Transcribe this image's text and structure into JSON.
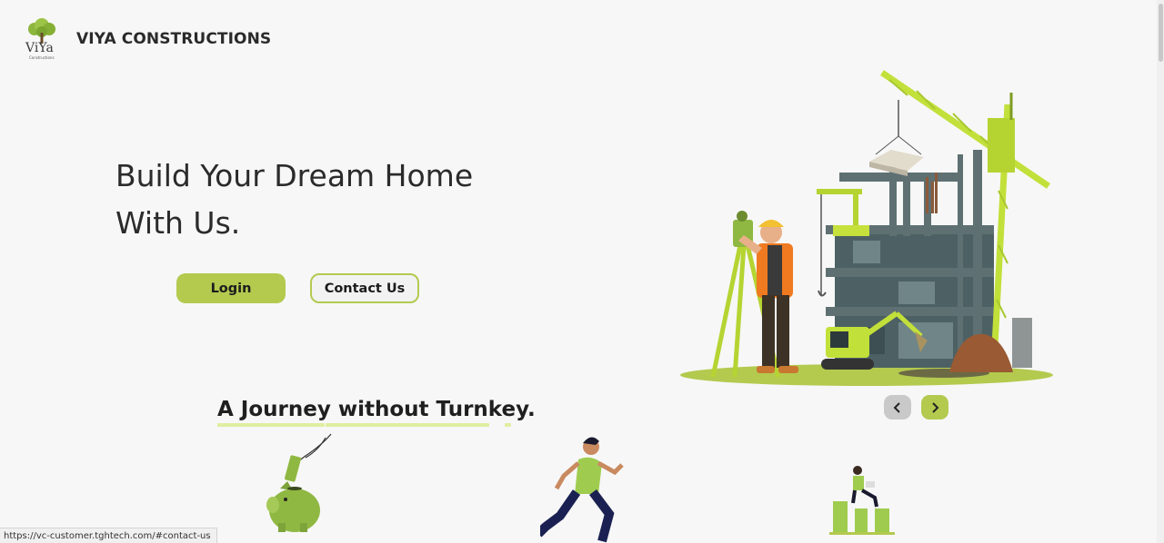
{
  "header": {
    "logo_text": "ViYa",
    "logo_subtext": "Constructions",
    "brand_name": "VIYA CONSTRUCTIONS"
  },
  "hero": {
    "title_line1": "Build Your Dream Home",
    "title_line2": "With Us.",
    "login_label": "Login",
    "contact_label": "Contact Us"
  },
  "carousel": {
    "prev_icon": "chevron-left-icon",
    "next_icon": "chevron-right-icon"
  },
  "journey": {
    "title": "A Journey without Turnkey."
  },
  "status_bar": {
    "url": "https://vc-customer.tghtech.com/#contact-us"
  },
  "colors": {
    "accent": "#b3ca4f",
    "accent_light": "#dfeea0",
    "background": "#f7f7f7",
    "text": "#222222"
  }
}
